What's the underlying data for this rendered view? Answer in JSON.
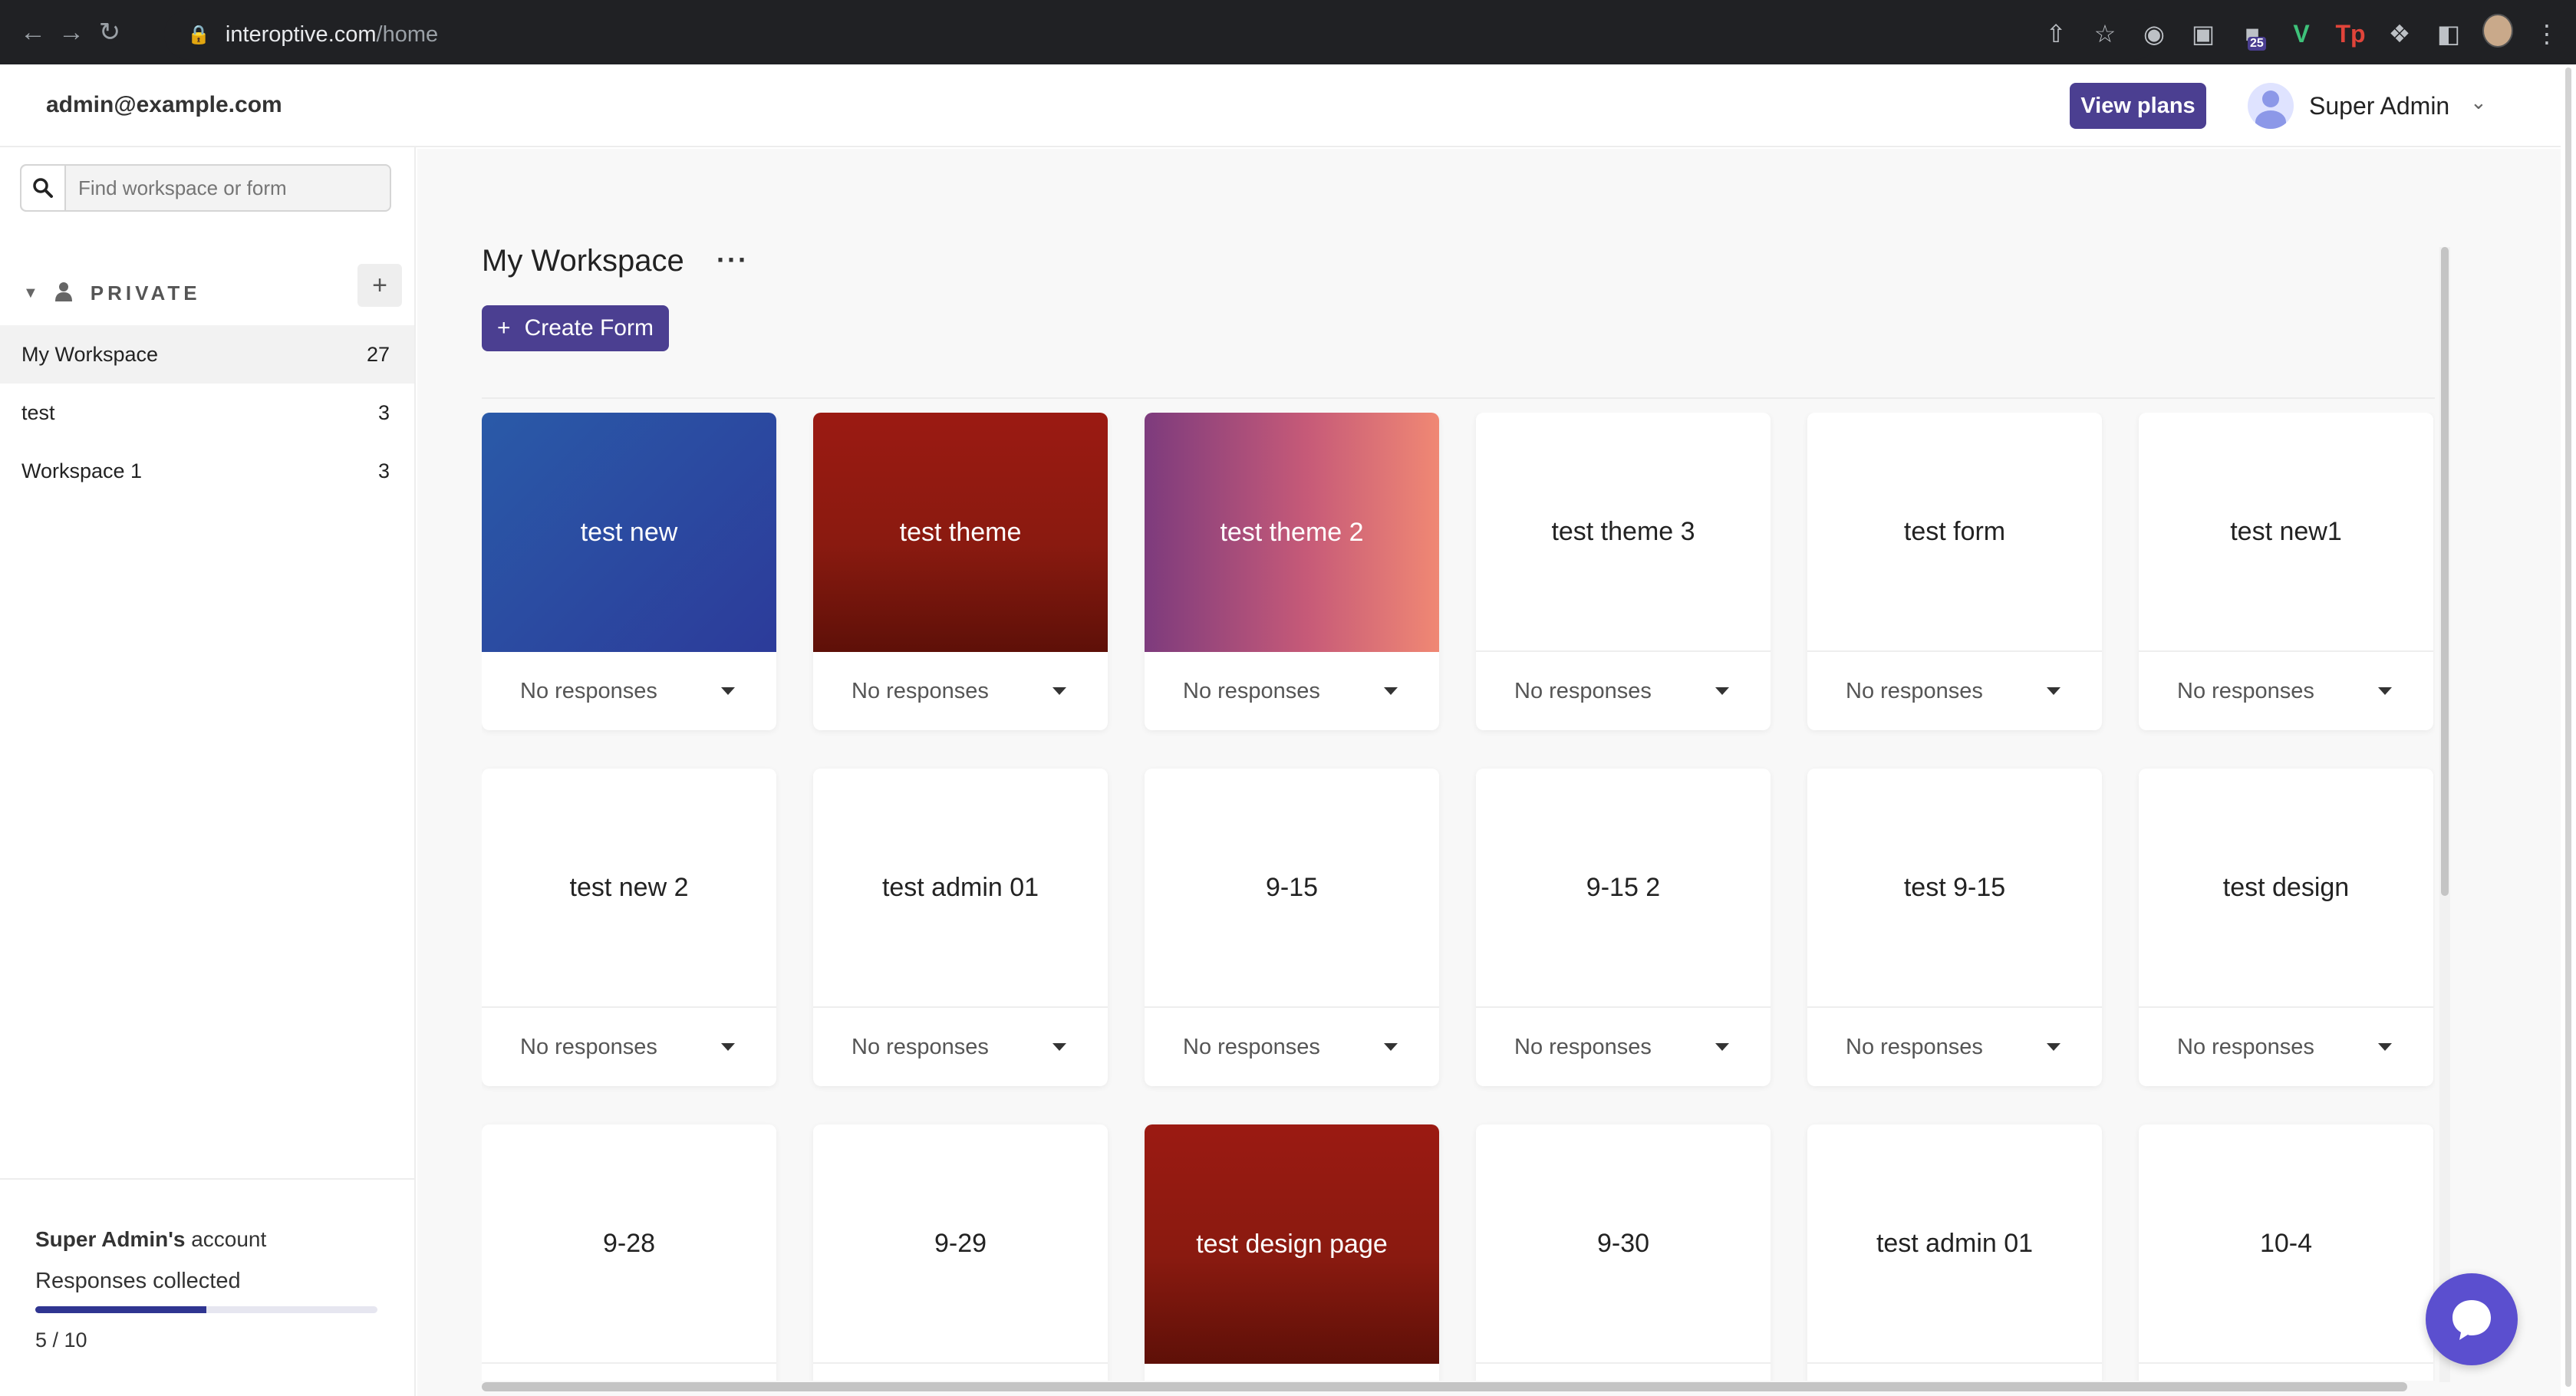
{
  "browser": {
    "url_host": "interoptive.com",
    "url_path": "/home",
    "extension_badge": "25"
  },
  "header": {
    "email": "admin@example.com",
    "view_plans": "View plans",
    "user_name": "Super Admin"
  },
  "sidebar": {
    "search_placeholder": "Find workspace or form",
    "section_label": "PRIVATE",
    "add_label": "+",
    "workspaces": [
      {
        "name": "My Workspace",
        "count": "27"
      },
      {
        "name": "test",
        "count": "3"
      },
      {
        "name": "Workspace 1",
        "count": "3"
      }
    ],
    "account": {
      "owner": "Super Admin's",
      "suffix": "account",
      "responses_label": "Responses collected",
      "responses_text": "5 / 10",
      "responses_fraction": 0.5
    }
  },
  "main": {
    "title": "My Workspace",
    "more_label": "···",
    "create_button": "Create Form",
    "forms": [
      {
        "name": "test new",
        "responses": "No responses",
        "cover": "blue"
      },
      {
        "name": "test theme",
        "responses": "No responses",
        "cover": "red"
      },
      {
        "name": "test theme 2",
        "responses": "No responses",
        "cover": "pink"
      },
      {
        "name": "test theme 3",
        "responses": "No responses",
        "cover": "white"
      },
      {
        "name": "test form",
        "responses": "No responses",
        "cover": "white"
      },
      {
        "name": "test new1",
        "responses": "No responses",
        "cover": "white"
      },
      {
        "name": "test new 2",
        "responses": "No responses",
        "cover": "white"
      },
      {
        "name": "test admin 01",
        "responses": "No responses",
        "cover": "white"
      },
      {
        "name": "9-15",
        "responses": "No responses",
        "cover": "white"
      },
      {
        "name": "9-15 2",
        "responses": "No responses",
        "cover": "white"
      },
      {
        "name": "test 9-15",
        "responses": "No responses",
        "cover": "white"
      },
      {
        "name": "test design",
        "responses": "No responses",
        "cover": "white"
      },
      {
        "name": "9-28",
        "responses": "",
        "cover": "white"
      },
      {
        "name": "9-29",
        "responses": "",
        "cover": "white"
      },
      {
        "name": "test design page",
        "responses": "",
        "cover": "red"
      },
      {
        "name": "9-30",
        "responses": "",
        "cover": "white"
      },
      {
        "name": "test admin 01",
        "responses": "",
        "cover": "white"
      },
      {
        "name": "10-4",
        "responses": "",
        "cover": "white"
      }
    ]
  },
  "colors": {
    "brand": "#4b3f91",
    "chat": "#5b4fcf",
    "progress": "#2f3591"
  }
}
